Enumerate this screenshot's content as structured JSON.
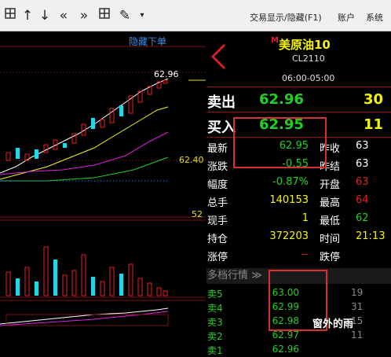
{
  "toolbar": {
    "icons": [
      "grid-icon",
      "arrow-up-icon",
      "arrow-down-icon",
      "double-left-icon",
      "double-right-icon",
      "table-icon",
      "pen-icon",
      "dropdown-icon"
    ],
    "menu_trade": "交易显示/隐藏(F1)",
    "menu_account": "账户",
    "menu_system": "系统"
  },
  "chart": {
    "hide_order_label": "隐藏下单",
    "price_high": "62.96",
    "price_mid": "62.40",
    "price_low": "52"
  },
  "quote": {
    "name_marker": "M",
    "name": "美原油10",
    "code": "CL2110",
    "session": "06:00-05:00",
    "sell_label": "卖出",
    "sell_price": "62.96",
    "sell_vol": "30",
    "buy_label": "买入",
    "buy_price": "62.95",
    "buy_vol": "11",
    "rows": [
      {
        "l1": "最新",
        "v1": "62.95",
        "l2": "昨收",
        "v2": "63"
      },
      {
        "l1": "涨跌",
        "v1": "-0.55",
        "l2": "昨结",
        "v2": "63"
      },
      {
        "l1": "幅度",
        "v1": "-0.87%",
        "l2": "开盘",
        "v2": "63"
      },
      {
        "l1": "总手",
        "v1": "140153",
        "l2": "最高",
        "v2": "64"
      },
      {
        "l1": "现手",
        "v1": "1",
        "l2": "最低",
        "v2": "62"
      },
      {
        "l1": "持仓",
        "v1": "372203",
        "l2": "时间",
        "v2": "21:13"
      },
      {
        "l1": "涨停",
        "v1": "--",
        "l2": "跌停",
        "v2": ""
      }
    ],
    "depth_title": "多档行情 ≫",
    "depth": [
      {
        "label": "卖5",
        "price": "63.00",
        "vol": "19"
      },
      {
        "label": "卖4",
        "price": "62.99",
        "vol": "31"
      },
      {
        "label": "卖3",
        "price": "62.98",
        "vol": "15"
      },
      {
        "label": "卖2",
        "price": "62.97",
        "vol": "11"
      },
      {
        "label": "卖1",
        "price": "62.96",
        "vol": ""
      }
    ]
  },
  "watermark": "窗外的雨",
  "colors": {
    "up": "#e82020",
    "down": "#22d022",
    "cyan": "#20d8e8",
    "yellow": "#f5f500"
  }
}
